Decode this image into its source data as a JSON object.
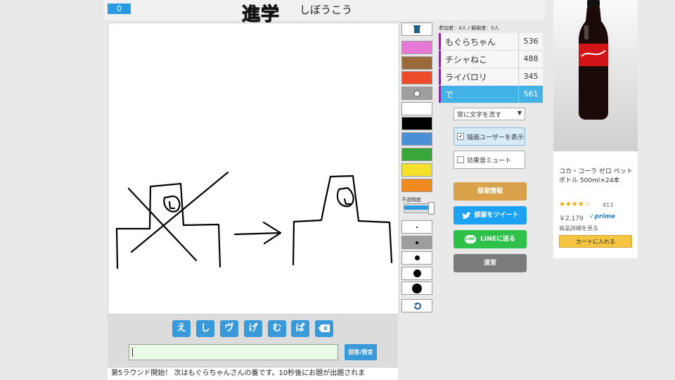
{
  "header": {
    "counter": "0",
    "title": "進学",
    "hint": "しぼうこう"
  },
  "palette": {
    "colors": [
      "#e779d6",
      "#9b6a3b",
      "#ee4b2b",
      "#9e9e9e",
      "#ffffff",
      "#000000",
      "#4a90d9",
      "#3aa53a",
      "#f5e02a",
      "#f08a1f"
    ],
    "opacity_label": "不透明度",
    "opacity_value": 0.85,
    "trash_icon": "trash-icon",
    "undo_icon": "undo-icon"
  },
  "players": {
    "header": "参加者：4人 / 観戦者：0人",
    "rows": [
      {
        "name": "もぐらちゃん",
        "score": "536"
      },
      {
        "name": "チシャねこ",
        "score": "488"
      },
      {
        "name": "ライバロリ",
        "score": "345"
      },
      {
        "name": "で",
        "score": "561"
      }
    ]
  },
  "controls": {
    "stream_select": "常に文字を流す",
    "show_drawer": "描画ユーザーを表示",
    "mute": "効果音ミュート",
    "room_info": "部屋情報",
    "tweet": "部屋をツイート",
    "line": "LINEに送る",
    "leave": "退室"
  },
  "chat": {
    "kana": [
      "え",
      "し",
      "ヴ",
      "げ",
      "む",
      "ぱ"
    ],
    "send_label": "回答/発言",
    "log": "第5ラウンド開始！ 次はもぐらちゃんさんの番です。10秒後にお題が出題されま"
  },
  "ad": {
    "name": "コカ・コーラ ゼロ ペットボトル 500ml×24本",
    "stars": "★★★★☆",
    "reviews": "913",
    "price": "￥2,179",
    "prime": "✓prime",
    "detail": "商品詳細を見る",
    "cart": "カートに入れる"
  }
}
